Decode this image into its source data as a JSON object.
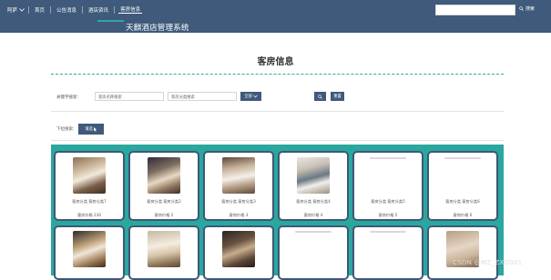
{
  "topbar": {
    "user": "阿萨",
    "nav": [
      {
        "label": "首页",
        "active": false
      },
      {
        "label": "公告消息",
        "active": false
      },
      {
        "label": "酒店资讯",
        "active": false
      },
      {
        "label": "客房信息",
        "active": true
      }
    ],
    "system_title": "天麒酒店管理系统",
    "search_placeholder": "",
    "search_label": "搜索"
  },
  "page": {
    "title": "客房信息"
  },
  "filters": {
    "label": "关键字搜索:",
    "name_placeholder": "客房名称搜索",
    "type_placeholder": "客房分类搜索",
    "select_label": "全部",
    "reset_label": "重置"
  },
  "dropdown": {
    "label": "下拉搜索:",
    "button_label": "请选"
  },
  "cards": [
    {
      "name": "客房分类 客房分类7",
      "price": "客房价格 230"
    },
    {
      "name": "客房分类 客房分类2",
      "price": "客房价格 2"
    },
    {
      "name": "客房分类 客房分类3",
      "price": "客房价格 3"
    },
    {
      "name": "客房分类 客房分类4",
      "price": "客房价格 4"
    },
    {
      "name": "客房分类 客房分类5",
      "price": "客房价格 5"
    },
    {
      "name": "客房分类 客房分类6",
      "price": "客房价格 6"
    },
    {
      "name": "",
      "price": ""
    },
    {
      "name": "",
      "price": ""
    },
    {
      "name": "",
      "price": ""
    },
    {
      "name": "",
      "price": ""
    },
    {
      "name": "",
      "price": ""
    },
    {
      "name": "",
      "price": ""
    }
  ],
  "watermark": "CSDN @MZ_ZXD001",
  "colors": {
    "navy": "#3f5a7a",
    "teal": "#2aa79f"
  }
}
